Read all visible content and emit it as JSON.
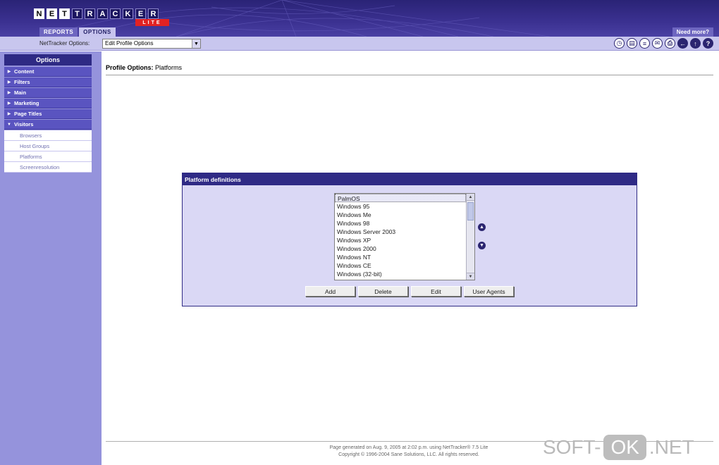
{
  "header": {
    "logo_letters": [
      "N",
      "E",
      "T",
      "T",
      "R",
      "A",
      "C",
      "K",
      "E",
      "R"
    ],
    "logo_sub": "LITE",
    "tabs": [
      {
        "label": "REPORTS",
        "active": false
      },
      {
        "label": "OPTIONS",
        "active": true
      }
    ],
    "need_more": "Need more?"
  },
  "toolbar": {
    "label": "NetTracker Options:",
    "select_value": "Edit Profile Options",
    "icons": [
      "clock-icon",
      "page-icon",
      "list-icon",
      "mail-icon",
      "print-icon",
      "back-icon",
      "up-icon",
      "help-icon"
    ]
  },
  "sidebar": {
    "title": "Options",
    "items": [
      {
        "label": "Content",
        "expanded": false
      },
      {
        "label": "Filters",
        "expanded": false
      },
      {
        "label": "Main",
        "expanded": false
      },
      {
        "label": "Marketing",
        "expanded": false
      },
      {
        "label": "Page Titles",
        "expanded": false
      },
      {
        "label": "Visitors",
        "expanded": true
      }
    ],
    "subitems": [
      "Browsers",
      "Host Groups",
      "Platforms",
      "Screenresolution"
    ]
  },
  "main": {
    "title_bold": "Profile Options:",
    "title_rest": " Platforms",
    "panel": {
      "title": "Platform definitions",
      "list": [
        "PalmOS",
        "Windows 95",
        "Windows Me",
        "Windows 98",
        "Windows Server 2003",
        "Windows XP",
        "Windows 2000",
        "Windows NT",
        "Windows CE",
        "Windows (32-bit)"
      ],
      "buttons": {
        "add": "Add",
        "delete": "Delete",
        "edit": "Edit",
        "user_agents": "User Agents"
      }
    }
  },
  "footer": {
    "line1": "Page generated on Aug. 9, 2005 at 2:02 p.m. using NetTracker® 7.5 Lite",
    "line2": "Copyright © 1996-2004 Sane Solutions, LLC. All rights reserved."
  },
  "watermark": {
    "left": "SOFT-",
    "middle": "OK",
    "right": ".NET"
  },
  "colors": {
    "brand_dark": "#2f2a85",
    "sidebar_bg": "#9593dc",
    "toolbar_bg": "#c8c6ee",
    "logo_red": "#e32222"
  }
}
